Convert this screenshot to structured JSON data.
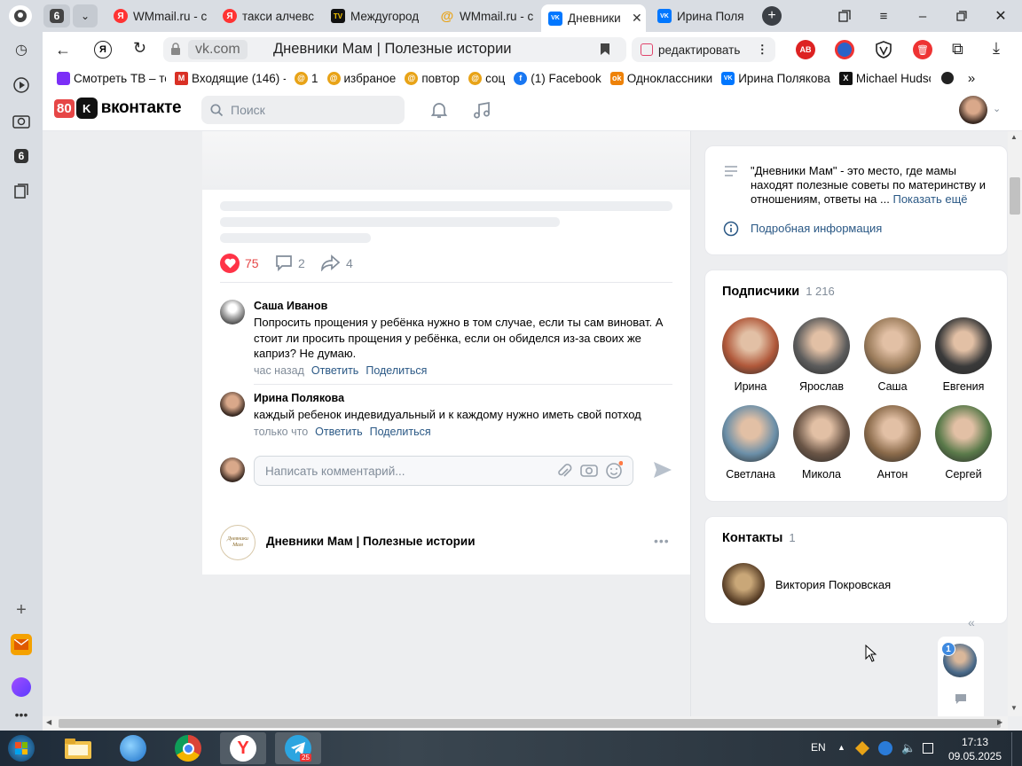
{
  "browser": {
    "tab_counter": "6",
    "tabs": [
      {
        "title": "WMmail.ru - с",
        "fav": "Я",
        "fav_color": "#f33"
      },
      {
        "title": "такси алчевс",
        "fav": "Я",
        "fav_color": "#f33"
      },
      {
        "title": "Междугород",
        "fav": "TV",
        "fav_color": "#111"
      },
      {
        "title": "WMmail.ru - с",
        "fav": "@",
        "fav_color": "#e8a317"
      },
      {
        "title": "Дневники",
        "fav": "VK",
        "fav_color": "#0077ff"
      },
      {
        "title": "Ирина Поля",
        "fav": "VK",
        "fav_color": "#0077ff"
      }
    ],
    "url_domain": "vk.com",
    "page_title": "Дневники Мам | Полезные истории",
    "edit_button": "редактировать",
    "bookmarks": [
      {
        "label": "Смотреть ТВ – те",
        "color": "#7b2ff7"
      },
      {
        "label": "Входящие (146) -",
        "color": "#d93025"
      },
      {
        "label": "1",
        "color": "#e8a317"
      },
      {
        "label": "избраное",
        "color": "#e8a317"
      },
      {
        "label": "повтор",
        "color": "#e8a317"
      },
      {
        "label": "соц",
        "color": "#e8a317"
      },
      {
        "label": "(1) Facebook",
        "color": "#1877f2"
      },
      {
        "label": "Одноклассники",
        "color": "#ee8208"
      },
      {
        "label": "Ирина Полякова",
        "color": "#0077ff"
      },
      {
        "label": "Michael Hudso",
        "color": "#111"
      }
    ],
    "sidebar_badge": "6"
  },
  "vk": {
    "logo_badge": "80",
    "logo_text": "вконтакте",
    "search_placeholder": "Поиск"
  },
  "post": {
    "likes": "75",
    "comments": "2",
    "shares": "4",
    "comment_list": [
      {
        "author": "Саша Иванов",
        "text": "Попросить прощения у ребёнка нужно в том случае, если ты сам виноват. А стоит ли просить прощения у ребёнка, если он обиделся из-за своих же каприз? Не думаю.",
        "time": "час назад",
        "reply": "Ответить",
        "share": "Поделиться"
      },
      {
        "author": "Ирина Полякова",
        "text": "каждый ребенок индевидуальный и к каждому нужно иметь свой потход",
        "time": "только что",
        "reply": "Ответить",
        "share": "Поделиться"
      }
    ],
    "comment_placeholder": "Написать комментарий..."
  },
  "next_post": {
    "group_name": "Дневники Мам | Полезные истории",
    "logo_text": "Дневники Мам"
  },
  "about": {
    "text": "\"Дневники Мам\" - это место, где мамы находят полезные советы по материнству и отношениям, ответы на ...",
    "more": "Показать ещё",
    "details": "Подробная информация"
  },
  "subscribers": {
    "title": "Подписчики",
    "count": "1 216",
    "people": [
      {
        "name": "Ирина",
        "color": "#b0583a"
      },
      {
        "name": "Ярослав",
        "color": "#5c5c5c"
      },
      {
        "name": "Саша",
        "color": "#9a7b5a"
      },
      {
        "name": "Евгения",
        "color": "#3a3a3a"
      },
      {
        "name": "Светлана",
        "color": "#6b8fa8"
      },
      {
        "name": "Микола",
        "color": "#6a5546"
      },
      {
        "name": "Антон",
        "color": "#8a6a4a"
      },
      {
        "name": "Сергей",
        "color": "#5a7a4a"
      }
    ]
  },
  "contacts": {
    "title": "Контакты",
    "count": "1",
    "name": "Виктория Покровская"
  },
  "chat_badge": "1",
  "taskbar": {
    "lang": "EN",
    "time": "17:13",
    "date": "09.05.2025",
    "telegram_badge": "25"
  }
}
